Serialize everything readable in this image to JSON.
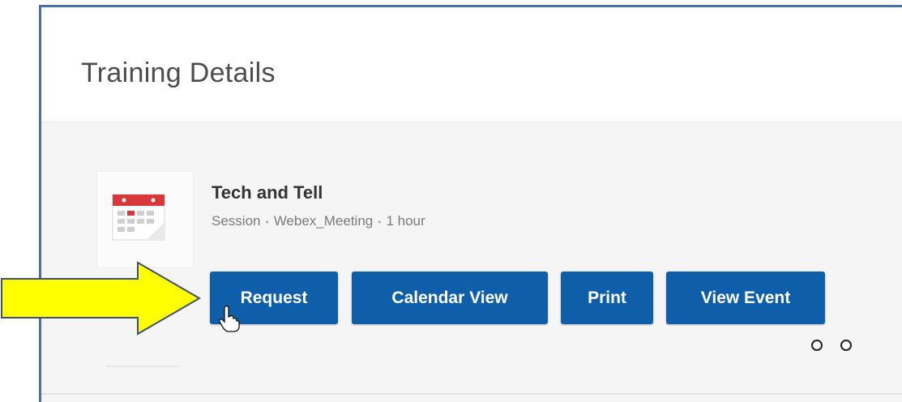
{
  "page": {
    "title": "Training Details"
  },
  "training": {
    "title": "Tech and Tell",
    "type": "Session",
    "location": "Webex_Meeting",
    "duration": "1 hour",
    "thumbnail_icon": "calendar-icon"
  },
  "actions": {
    "request": "Request",
    "calendar_view": "Calendar View",
    "print": "Print",
    "view_event": "View Event"
  },
  "annotation": {
    "arrow_color": "#ffff00",
    "arrow_outline": "#3f4f7a"
  },
  "colors": {
    "button": "#0f5ea9",
    "frame_border": "#4a6fa5"
  }
}
